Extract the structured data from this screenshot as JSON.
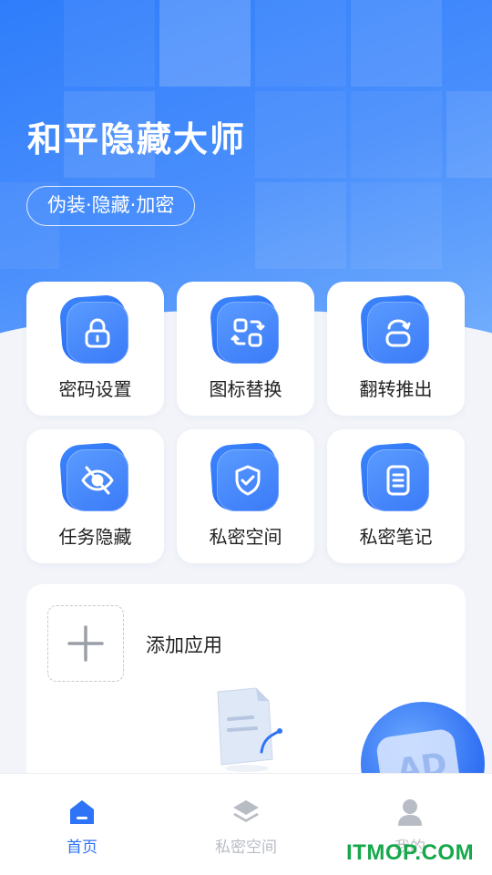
{
  "header": {
    "app_title": "和平隐藏大师",
    "tagline": "伪装·隐藏·加密"
  },
  "features": [
    {
      "label": "密码设置",
      "icon": "lock-icon"
    },
    {
      "label": "图标替换",
      "icon": "icon-swap-icon"
    },
    {
      "label": "翻转推出",
      "icon": "flip-icon"
    },
    {
      "label": "任务隐藏",
      "icon": "eye-off-icon"
    },
    {
      "label": "私密空间",
      "icon": "shield-check-icon"
    },
    {
      "label": "私密笔记",
      "icon": "notes-icon"
    }
  ],
  "add_app": {
    "label": "添加应用"
  },
  "ad_float": {
    "text": "AD"
  },
  "tabbar": {
    "items": [
      {
        "label": "首页",
        "icon": "home-icon",
        "active": true
      },
      {
        "label": "私密空间",
        "icon": "layers-icon",
        "active": false
      },
      {
        "label": "我的",
        "icon": "user-icon",
        "active": false
      }
    ]
  },
  "watermark": "ITMOP.COM",
  "colors": {
    "primary": "#2f73f6",
    "tab_inactive": "#b8bcc4",
    "watermark": "#17a84b"
  }
}
